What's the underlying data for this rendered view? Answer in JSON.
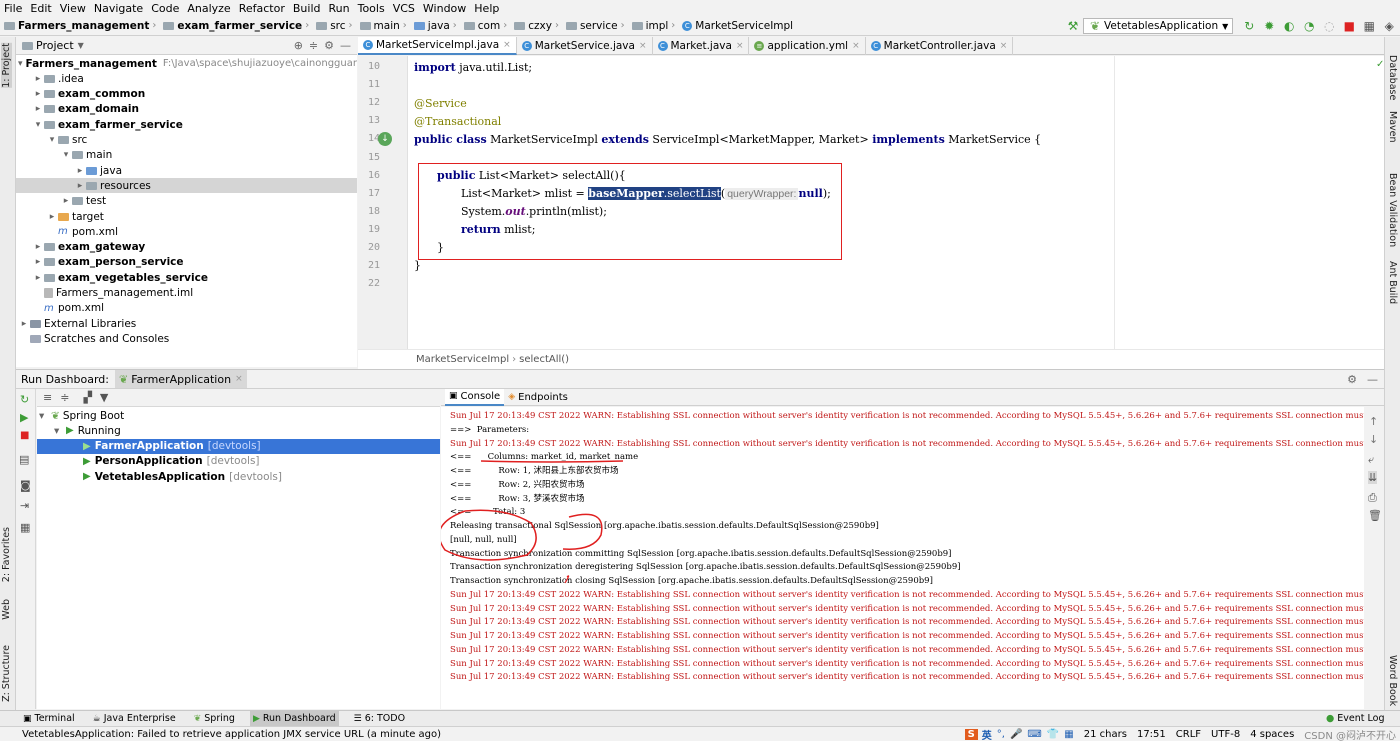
{
  "menu": [
    "File",
    "Edit",
    "View",
    "Navigate",
    "Code",
    "Analyze",
    "Refactor",
    "Build",
    "Run",
    "Tools",
    "VCS",
    "Window",
    "Help"
  ],
  "breadcrumb": [
    "Farmers_management",
    "exam_farmer_service",
    "src",
    "main",
    "java",
    "com",
    "czxy",
    "service",
    "impl",
    "MarketServiceImpl"
  ],
  "run_config": "VetetablesApplication",
  "left_stripe": {
    "project": "1: Project",
    "favorites": "2: Favorites",
    "web": "Web",
    "structure": "Z: Structure"
  },
  "right_stripe": {
    "database": "Database",
    "maven": "Maven",
    "bean": "Bean Validation",
    "ant": "Ant Build",
    "wordbook": "Word Book"
  },
  "project": {
    "title": "Project",
    "tree": [
      {
        "label": "Farmers_management",
        "extra": "F:\\Java\\space\\shujiazuoye\\cainongguanli\\before\\",
        "depth": 0,
        "arrow": "v",
        "bold": true,
        "icon": "folder"
      },
      {
        "label": ".idea",
        "depth": 1,
        "arrow": ">",
        "bold": false,
        "icon": "folder"
      },
      {
        "label": "exam_common",
        "depth": 1,
        "arrow": ">",
        "bold": true,
        "icon": "folder"
      },
      {
        "label": "exam_domain",
        "depth": 1,
        "arrow": ">",
        "bold": true,
        "icon": "folder"
      },
      {
        "label": "exam_farmer_service",
        "depth": 1,
        "arrow": "v",
        "bold": true,
        "icon": "folder"
      },
      {
        "label": "src",
        "depth": 2,
        "arrow": "v",
        "bold": false,
        "icon": "folder"
      },
      {
        "label": "main",
        "depth": 3,
        "arrow": "v",
        "bold": false,
        "icon": "folder"
      },
      {
        "label": "java",
        "depth": 4,
        "arrow": ">",
        "bold": false,
        "icon": "folder-blue"
      },
      {
        "label": "resources",
        "depth": 4,
        "arrow": ">",
        "bold": false,
        "icon": "folder",
        "selected": true
      },
      {
        "label": "test",
        "depth": 3,
        "arrow": ">",
        "bold": false,
        "icon": "folder"
      },
      {
        "label": "target",
        "depth": 2,
        "arrow": ">",
        "bold": false,
        "icon": "folder-orange"
      },
      {
        "label": "pom.xml",
        "depth": 2,
        "arrow": "",
        "bold": false,
        "icon": "maven"
      },
      {
        "label": "exam_gateway",
        "depth": 1,
        "arrow": ">",
        "bold": true,
        "icon": "folder"
      },
      {
        "label": "exam_person_service",
        "depth": 1,
        "arrow": ">",
        "bold": true,
        "icon": "folder"
      },
      {
        "label": "exam_vegetables_service",
        "depth": 1,
        "arrow": ">",
        "bold": true,
        "icon": "folder"
      },
      {
        "label": "Farmers_management.iml",
        "depth": 1,
        "arrow": "",
        "bold": false,
        "icon": "file"
      },
      {
        "label": "pom.xml",
        "depth": 1,
        "arrow": "",
        "bold": false,
        "icon": "maven"
      },
      {
        "label": "External Libraries",
        "depth": 0,
        "arrow": ">",
        "bold": false,
        "icon": "lib"
      },
      {
        "label": "Scratches and Consoles",
        "depth": 0,
        "arrow": "",
        "bold": false,
        "icon": "scratch"
      }
    ]
  },
  "editor": {
    "tabs": [
      {
        "label": "MarketServiceImpl.java",
        "active": true
      },
      {
        "label": "MarketService.java",
        "active": false
      },
      {
        "label": "Market.java",
        "active": false
      },
      {
        "label": "application.yml",
        "active": false
      },
      {
        "label": "MarketController.java",
        "active": false
      }
    ],
    "line_numbers": [
      "10",
      "11",
      "12",
      "13",
      "14",
      "15",
      "16",
      "17",
      "18",
      "19",
      "20",
      "21",
      "22"
    ],
    "code": {
      "l10_kw": "import",
      "l10_rest": " java.util.List;",
      "l12": "@Service",
      "l13": "@Transactional",
      "l14_a": "public class",
      "l14_b": " MarketServiceImpl ",
      "l14_c": "extends",
      "l14_d": " ServiceImpl<MarketMapper, Market> ",
      "l14_e": "implements",
      "l14_f": " MarketService {",
      "l16_kw": "public",
      "l16_rest": " List<Market> selectAll(){",
      "l17_a": "List<Market> mlist = ",
      "l17_b": "baseMapper",
      "l17_c": ".selectList",
      "l17_d": "(",
      "l17_hint": "queryWrapper:",
      "l17_null": "null",
      "l17_e": ");",
      "l18_a": "System.",
      "l18_b": "out",
      "l18_c": ".println(mlist);",
      "l19_kw": "return",
      "l19_rest": " mlist;",
      "l20": "}",
      "l21": "}"
    },
    "status_crumb": [
      "MarketServiceImpl",
      "selectAll()"
    ]
  },
  "dashboard": {
    "title": "Run Dashboard:",
    "tab": "FarmerApplication",
    "tree": [
      {
        "label": "Spring Boot",
        "depth": 0
      },
      {
        "label": "Running",
        "depth": 1
      },
      {
        "label": "FarmerApplication",
        "tag": "[devtools]",
        "depth": 2,
        "selected": true
      },
      {
        "label": "PersonApplication",
        "tag": "[devtools]",
        "depth": 2
      },
      {
        "label": "VetetablesApplication",
        "tag": "[devtools]",
        "depth": 2
      }
    ],
    "console_tabs": [
      "Console",
      "Endpoints"
    ],
    "console_lines": [
      {
        "text": "Sun Jul 17 20:13:49 CST 2022 WARN: Establishing SSL connection without server's identity verification is not recommended. According to MySQL 5.5.45+, 5.6.26+ and 5.7.6+ requirements SSL connection must be esta",
        "red": true
      },
      {
        "text": "==>  Parameters:",
        "red": false
      },
      {
        "text": "Sun Jul 17 20:13:49 CST 2022 WARN: Establishing SSL connection without server's identity verification is not recommended. According to MySQL 5.5.45+, 5.6.26+ and 5.7.6+ requirements SSL connection must be esta",
        "red": true
      },
      {
        "text": "<==      Columns: market_id, market_name",
        "red": false
      },
      {
        "text": "<==          Row: 1, 沭阳县上东部农贸市场",
        "red": false
      },
      {
        "text": "<==          Row: 2, 兴阳农贸市场",
        "red": false
      },
      {
        "text": "<==          Row: 3, 梦溪农贸市场",
        "red": false
      },
      {
        "text": "<==        Total: 3",
        "red": false
      },
      {
        "text": "Releasing transactional SqlSession [org.apache.ibatis.session.defaults.DefaultSqlSession@2590b9]",
        "red": false
      },
      {
        "text": "[null, null, null]",
        "red": false
      },
      {
        "text": "Transaction synchronization committing SqlSession [org.apache.ibatis.session.defaults.DefaultSqlSession@2590b9]",
        "red": false
      },
      {
        "text": "Transaction synchronization deregistering SqlSession [org.apache.ibatis.session.defaults.DefaultSqlSession@2590b9]",
        "red": false
      },
      {
        "text": "Transaction synchronization closing SqlSession [org.apache.ibatis.session.defaults.DefaultSqlSession@2590b9]",
        "red": false
      },
      {
        "text": "Sun Jul 17 20:13:49 CST 2022 WARN: Establishing SSL connection without server's identity verification is not recommended. According to MySQL 5.5.45+, 5.6.26+ and 5.7.6+ requirements SSL connection must be esta",
        "red": true
      },
      {
        "text": "Sun Jul 17 20:13:49 CST 2022 WARN: Establishing SSL connection without server's identity verification is not recommended. According to MySQL 5.5.45+, 5.6.26+ and 5.7.6+ requirements SSL connection must be esta",
        "red": true
      },
      {
        "text": "Sun Jul 17 20:13:49 CST 2022 WARN: Establishing SSL connection without server's identity verification is not recommended. According to MySQL 5.5.45+, 5.6.26+ and 5.7.6+ requirements SSL connection must be esta",
        "red": true
      },
      {
        "text": "Sun Jul 17 20:13:49 CST 2022 WARN: Establishing SSL connection without server's identity verification is not recommended. According to MySQL 5.5.45+, 5.6.26+ and 5.7.6+ requirements SSL connection must be esta",
        "red": true
      },
      {
        "text": "Sun Jul 17 20:13:49 CST 2022 WARN: Establishing SSL connection without server's identity verification is not recommended. According to MySQL 5.5.45+, 5.6.26+ and 5.7.6+ requirements SSL connection must be esta",
        "red": true
      },
      {
        "text": "Sun Jul 17 20:13:49 CST 2022 WARN: Establishing SSL connection without server's identity verification is not recommended. According to MySQL 5.5.45+, 5.6.26+ and 5.7.6+ requirements SSL connection must be esta",
        "red": true
      },
      {
        "text": "Sun Jul 17 20:13:49 CST 2022 WARN: Establishing SSL connection without server's identity verification is not recommended. According to MySQL 5.5.45+, 5.6.26+ and 5.7.6+ requirements SSL connection must be esta",
        "red": true
      }
    ]
  },
  "bottom_tabs": [
    {
      "label": "Terminal",
      "active": false
    },
    {
      "label": "Java Enterprise",
      "active": false
    },
    {
      "label": "Spring",
      "active": false
    },
    {
      "label": "Run Dashboard",
      "active": true
    },
    {
      "label": "6: TODO",
      "active": false
    }
  ],
  "event_log": "Event Log",
  "status": {
    "message": "VetetablesApplication: Failed to retrieve application JMX service URL (a minute ago)",
    "ime": "英",
    "chars": "21 chars",
    "position": "17:51",
    "line_sep": "CRLF",
    "encoding": "UTF-8",
    "indent": "4 spaces",
    "watermark": "CSDN @闷泸不开心"
  },
  "colors": {
    "keyword": "#000080",
    "annotation": "#808000",
    "warn": "#c01818",
    "selection": "#3875d7",
    "box": "#e02020"
  }
}
